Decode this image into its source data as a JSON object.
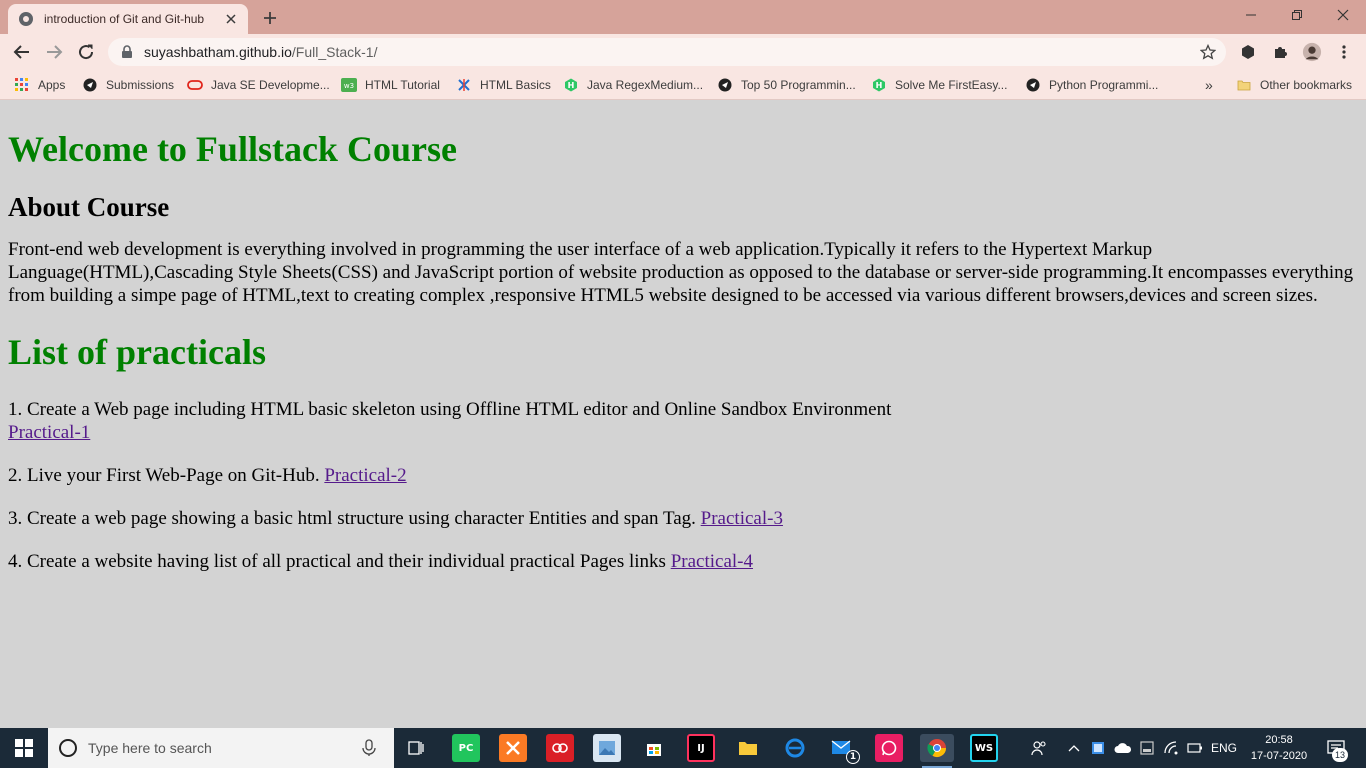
{
  "browser": {
    "tab": {
      "title": "introduction of Git and Git-hub"
    },
    "address": {
      "host": "suyashbatham.github.io",
      "path": "/Full_Stack-1/"
    },
    "bookmarks": [
      {
        "label": "Apps",
        "icon": "apps-grid-icon"
      },
      {
        "label": "Submissions",
        "icon": "submissions-icon"
      },
      {
        "label": "Java SE Developme...",
        "icon": "oracle-icon"
      },
      {
        "label": "HTML Tutorial",
        "icon": "w3schools-icon"
      },
      {
        "label": "HTML Basics",
        "icon": "html-basics-icon"
      },
      {
        "label": "Java RegexMedium...",
        "icon": "hackerrank-icon"
      },
      {
        "label": "Top 50 Programmin...",
        "icon": "top50-icon"
      },
      {
        "label": "Solve Me FirstEasy...",
        "icon": "hackerrank-icon"
      },
      {
        "label": "Python Programmi...",
        "icon": "python-icon"
      }
    ],
    "overflow_label": "»",
    "other_bookmarks": "Other bookmarks"
  },
  "page": {
    "welcome_heading": "Welcome to Fullstack Course",
    "about_heading": "About Course",
    "about_text": "Front-end web development is everything involved in programming the user interface of a web application.Typically it refers to the Hypertext Markup Language(HTML),Cascading Style Sheets(CSS) and JavaScript portion of website production as opposed to the database or server-side programming.It encompasses everything from building a simpe page of HTML,text to creating complex ,responsive HTML5 website designed to be accessed via various different browsers,devices and screen sizes.",
    "list_heading": "List of practicals",
    "practicals": [
      {
        "text": "1. Create a Web page including HTML basic skeleton using Offline HTML editor and Online Sandbox Environment",
        "link": "Practical-1"
      },
      {
        "text": "2. Live your First Web-Page on Git-Hub.",
        "link": "Practical-2"
      },
      {
        "text": "3. Create a web page showing a basic html structure using character Entities and span Tag.",
        "link": "Practical-3"
      },
      {
        "text": "4. Create a website having list of all practical and their individual practical Pages links",
        "link": "Practical-4"
      }
    ]
  },
  "taskbar": {
    "search_placeholder": "Type here to search",
    "language": "ENG",
    "time": "20:58",
    "date": "17-07-2020",
    "mail_badge": "1",
    "notification_count": "13"
  },
  "colors": {
    "tabstrip": "#d6a39a",
    "toolbar": "#f9e6e2",
    "page_bg": "#d3d3d3",
    "heading_green": "#008000",
    "link_purple": "#551a8b",
    "taskbar": "#1b2a38"
  }
}
